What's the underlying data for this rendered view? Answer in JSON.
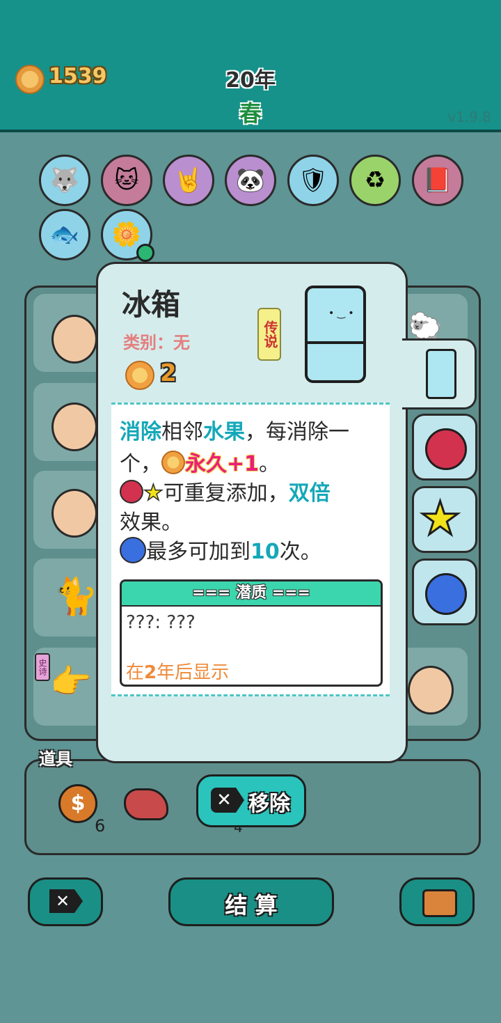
{
  "header": {
    "coins": "1539",
    "year": "20年",
    "season": "春",
    "version": "v1.9.8"
  },
  "relics": [
    {
      "name": "dog-cat-relic-icon"
    },
    {
      "name": "cats-relic-icon"
    },
    {
      "name": "rock-hand-relic-icon"
    },
    {
      "name": "panda-relic-icon"
    },
    {
      "name": "shield-wrench-relic-icon"
    },
    {
      "name": "recycle-relic-icon"
    },
    {
      "name": "time-magazine-relic-icon"
    },
    {
      "name": "fishbowl-relic-icon"
    },
    {
      "name": "potted-flower-relic-icon"
    }
  ],
  "popup": {
    "title": "冰箱",
    "category": "类别：无",
    "rarity": "传说",
    "cost": "2",
    "desc": {
      "l1_a": "消除",
      "l1_b": "相邻",
      "l1_c": "水果",
      "l1_d": "，每消除一",
      "l2_a": "个，",
      "l2_b": "永久+1",
      "l2_c": "。",
      "l3_a": "可重复添加，",
      "l3_b": "双倍",
      "l4": "效果。",
      "l5_a": "最多可加到",
      "l5_b": "10",
      "l5_c": "次。"
    },
    "potential": {
      "title": "=== 潜质 ===",
      "value": "???: ???",
      "reveal_a": "在",
      "reveal_b": "2",
      "reveal_c": "年后显示"
    }
  },
  "side_tabs": [
    {
      "name": "fridge-tab-icon"
    },
    {
      "name": "lychee-tab-icon"
    },
    {
      "name": "star-tab-icon"
    },
    {
      "name": "blueberry-tab-icon"
    }
  ],
  "items": {
    "label": "道具",
    "coin_count": "6",
    "other_count": "4"
  },
  "buttons": {
    "remove": "移除",
    "settle": "结 算"
  },
  "board": {
    "epic_tag": "史诗"
  },
  "colors": {
    "header": "#16928a",
    "accent": "#14a8b8",
    "popup_bg": "#d5ecec"
  }
}
